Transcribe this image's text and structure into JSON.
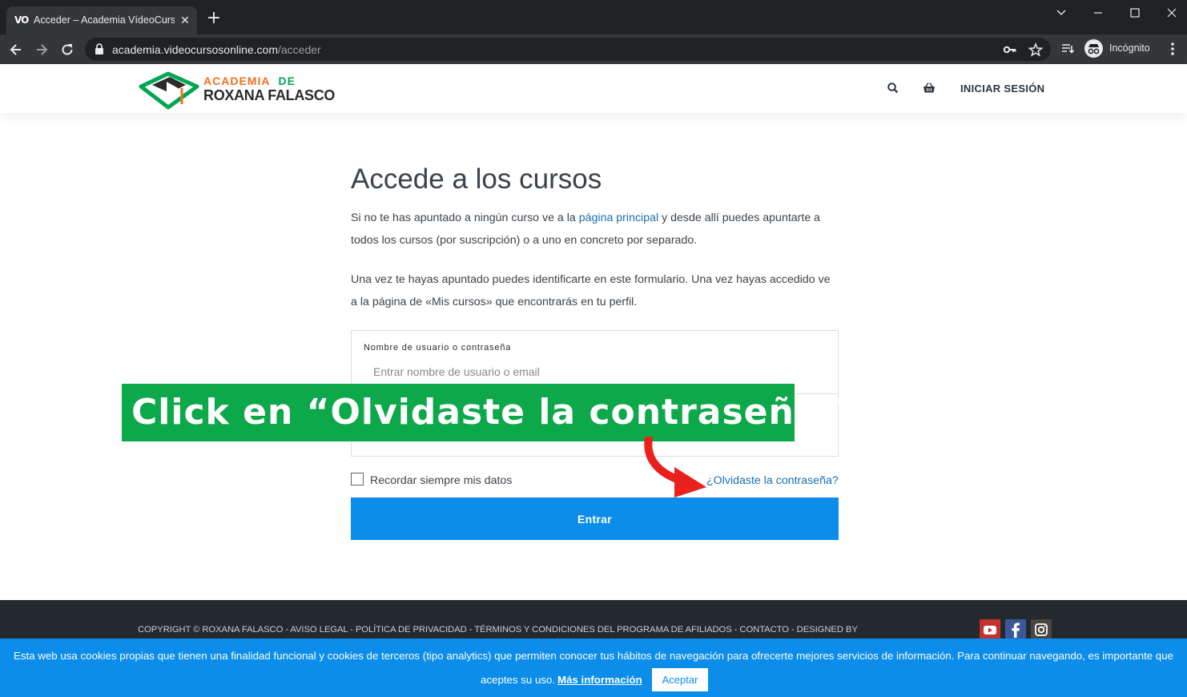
{
  "browser": {
    "tab": {
      "favicon_text": "VO",
      "title": "Acceder – Academia VídeoCursosOnline",
      "close": "✕"
    },
    "new_tab": "+",
    "url_host": "academia.videocursosonline.com",
    "url_path": "/acceder",
    "profile_label": "Incógnito"
  },
  "site": {
    "logo": {
      "line1": "ACADEMIA",
      "line1_de": "DE",
      "line2": "ROXANA FALASCO",
      "colors": {
        "orange": "#f26f21",
        "green": "#00a651",
        "dark": "#2b2b2b"
      }
    },
    "nav": {
      "login": "INICIAR SESIÓN"
    }
  },
  "main": {
    "heading": "Accede a los cursos",
    "para1_before": "Si no te has apuntado a ningún curso ve a la ",
    "para1_link": "página principal",
    "para1_after": " y desde allí puedes apuntarte a todos los cursos (por suscripción) o a uno en concreto por separado.",
    "para2": "Una vez te hayas apuntado puedes identificarte en este formulario. Una vez hayas accedido ve a la página de «Mis cursos» que encontrarás en tu perfil.",
    "form": {
      "username_label": "Nombre de usuario o contraseña",
      "username_placeholder": "Entrar nombre de usuario o email",
      "remember_label": "Recordar siempre mis datos",
      "forgot_link": "¿Olvidaste la contraseña?",
      "submit_label": "Entrar"
    }
  },
  "annotation": {
    "text": "Click en “Olvidaste la contraseña”",
    "color": "#0da84a",
    "arrow_color": "#e8211c"
  },
  "footer": {
    "links": "COPYRIGHT © ROXANA FALASCO - AVISO LEGAL - POLÍTICA DE PRIVACIDAD - TÉRMINOS Y CONDICIONES DEL PROGRAMA DE AFILIADOS - CONTACTO - DESIGNED BY",
    "social": [
      "youtube-icon",
      "facebook-icon",
      "instagram-icon"
    ]
  },
  "cookie": {
    "line1": "Esta web usa cookies propias que tienen una finalidad funcional y cookies de terceros (tipo analytics) que permiten conocer tus hábitos de navegación para ofrecerte mejores servicios de información. Para continuar navegando, es importante que",
    "line2": "aceptes su uso.",
    "more": "Más información",
    "accept": "Aceptar"
  },
  "colors": {
    "accent": "#0b8de9",
    "link": "#1b6fb0",
    "chrome_dark": "#202124",
    "chrome_toolbar": "#35363a",
    "footer_bg": "#24292d"
  }
}
